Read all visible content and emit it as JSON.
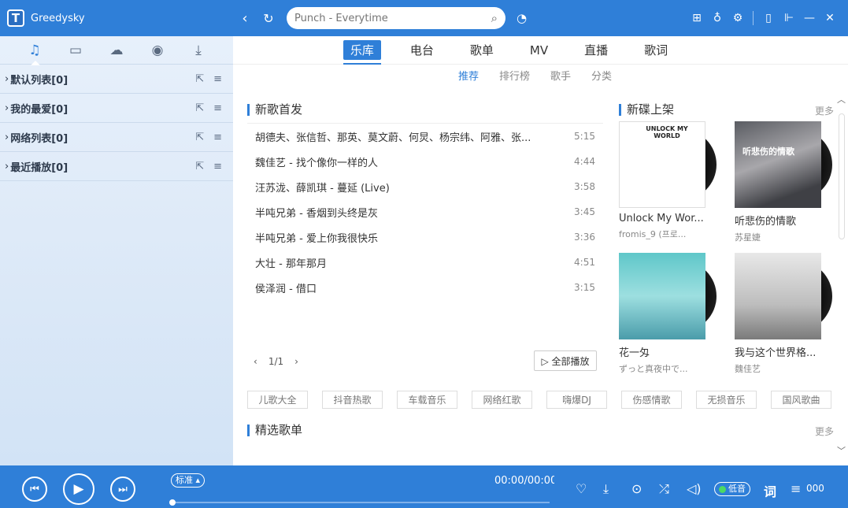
{
  "app": {
    "title": "Greedysky",
    "logo_letter": "T"
  },
  "search": {
    "placeholder": "Punch - Everytime"
  },
  "sidebar": {
    "tabs": [
      "music-note-icon",
      "device-icon",
      "cloud-icon",
      "radio-icon",
      "download-icon"
    ],
    "lists": [
      {
        "label": "默认列表[0]"
      },
      {
        "label": "我的最爱[0]"
      },
      {
        "label": "网络列表[0]"
      },
      {
        "label": "最近播放[0]"
      }
    ]
  },
  "main": {
    "tabs": [
      "乐库",
      "电台",
      "歌单",
      "MV",
      "直播",
      "歌词"
    ],
    "active_tab": "乐库",
    "subtabs": [
      "推荐",
      "排行榜",
      "歌手",
      "分类"
    ],
    "active_subtab": "推荐",
    "new_songs_title": "新歌首发",
    "new_albums_title": "新碟上架",
    "more_label": "更多",
    "songs": [
      {
        "name": "胡德夫、张信哲、那英、莫文蔚、何炅、杨宗纬、阿雅、张...",
        "duration": "5:15"
      },
      {
        "name": "魏佳艺 - 找个像你一样的人",
        "duration": "4:44"
      },
      {
        "name": "汪苏泷、薛凯琪 - 蔓延 (Live)",
        "duration": "3:58"
      },
      {
        "name": "半吨兄弟 - 香烟到头终是灰",
        "duration": "3:45"
      },
      {
        "name": "半吨兄弟 - 爱上你我很快乐",
        "duration": "3:36"
      },
      {
        "name": "大壮 - 那年那月",
        "duration": "4:51"
      },
      {
        "name": "侯泽润 - 借口",
        "duration": "3:15"
      }
    ],
    "pager": {
      "text": "1/1"
    },
    "play_all_label": "▷ 全部播放",
    "albums": [
      {
        "title": "Unlock My Wor...",
        "artist": "fromis_9 (프로...",
        "cover_text": "UNLOCK MY WORLD"
      },
      {
        "title": "听悲伤的情歌",
        "artist": "苏星婕",
        "cover_text": "听悲伤的情歌"
      },
      {
        "title": "花一匁",
        "artist": "ずっと真夜中で...",
        "cover_text": ""
      },
      {
        "title": "我与这个世界格...",
        "artist": "魏佳艺",
        "cover_text": ""
      }
    ],
    "genres": [
      "儿歌大全",
      "抖音热歌",
      "车载音乐",
      "网络红歌",
      "嗨爆DJ",
      "伤感情歌",
      "无损音乐",
      "国风歌曲"
    ],
    "playlists_title": "精选歌单"
  },
  "player": {
    "quality": "标准",
    "time": "00:00/00:00",
    "low_sound_label": "低音",
    "lyrics_label": "词",
    "queue_count": "000"
  }
}
